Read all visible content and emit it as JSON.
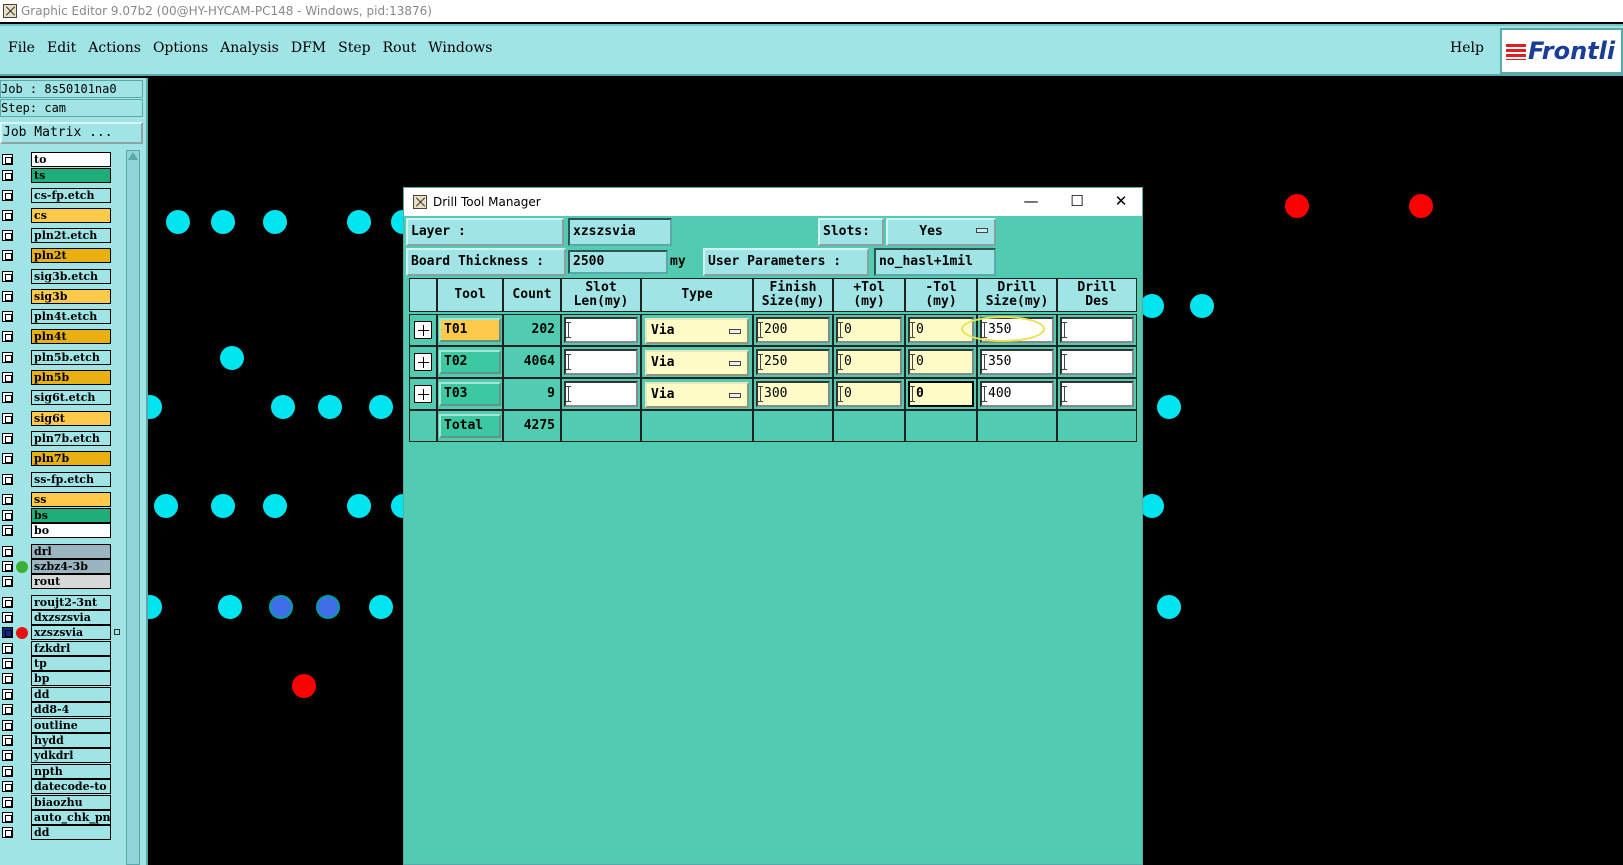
{
  "window_title": "Graphic Editor 9.07b2 (00@HY-HYCAM-PC148 - Windows, pid:13876)",
  "menu": [
    "File",
    "Edit",
    "Actions",
    "Options",
    "Analysis",
    "DFM",
    "Step",
    "Rout",
    "Windows"
  ],
  "help_label": "Help",
  "logo_text": "Frontli",
  "job_label": "Job : 8s50101na0",
  "step_label": "Step: cam",
  "job_matrix_label": "Job Matrix ...",
  "layers": [
    {
      "name": "to",
      "color": "#ffffff"
    },
    {
      "name": "ts",
      "color": "#1fae7a"
    },
    {
      "name": "cs-fp.etch",
      "color": "#a0e4e6"
    },
    {
      "name": "cs",
      "color": "#ffc94a"
    },
    {
      "name": "pln2t.etch",
      "color": "#a0e4e6"
    },
    {
      "name": "pln2t",
      "color": "#e8b010"
    },
    {
      "name": "sig3b.etch",
      "color": "#a0e4e6"
    },
    {
      "name": "sig3b",
      "color": "#ffc94a"
    },
    {
      "name": "pln4t.etch",
      "color": "#a0e4e6"
    },
    {
      "name": "pln4t",
      "color": "#e8b010"
    },
    {
      "name": "pln5b.etch",
      "color": "#a0e4e6"
    },
    {
      "name": "pln5b",
      "color": "#e8b010"
    },
    {
      "name": "sig6t.etch",
      "color": "#a0e4e6"
    },
    {
      "name": "sig6t",
      "color": "#ffc94a"
    },
    {
      "name": "pln7b.etch",
      "color": "#a0e4e6"
    },
    {
      "name": "pln7b",
      "color": "#e8b010"
    },
    {
      "name": "ss-fp.etch",
      "color": "#a0e4e6"
    },
    {
      "name": "ss",
      "color": "#ffc94a"
    },
    {
      "name": "bs",
      "color": "#1fae7a"
    },
    {
      "name": "bo",
      "color": "#ffffff"
    },
    {
      "name": "drl",
      "color": "#9ab4c0"
    },
    {
      "name": "szbz4-3b",
      "color": "#9ab4c0"
    },
    {
      "name": "rout",
      "color": "#d8d8d8"
    },
    {
      "name": "roujt2-3nt",
      "color": "#a0e4e6"
    },
    {
      "name": "dxzszsvia",
      "color": "#a0e4e6"
    },
    {
      "name": "xzszsvia",
      "color": "#a0e4e6"
    },
    {
      "name": "fzkdrl",
      "color": "#a0e4e6"
    },
    {
      "name": "tp",
      "color": "#a0e4e6"
    },
    {
      "name": "bp",
      "color": "#a0e4e6"
    },
    {
      "name": "dd",
      "color": "#a0e4e6"
    },
    {
      "name": "dd8-4",
      "color": "#a0e4e6"
    },
    {
      "name": "outline",
      "color": "#a0e4e6"
    },
    {
      "name": "hydd",
      "color": "#a0e4e6"
    },
    {
      "name": "ydkdrl",
      "color": "#a0e4e6"
    },
    {
      "name": "npth",
      "color": "#a0e4e6"
    },
    {
      "name": "datecode-to",
      "color": "#a0e4e6"
    },
    {
      "name": "biaozhu",
      "color": "#a0e4e6"
    },
    {
      "name": "auto_chk_pn",
      "color": "#a0e4e6"
    },
    {
      "name": "dd",
      "color": "#a0e4e6"
    }
  ],
  "dialog": {
    "title": "Drill Tool Manager",
    "layer_label": "Layer          :",
    "layer_value": "xzszsvia",
    "slots_label": "Slots:",
    "slots_value": "Yes",
    "board_thickness_label": "Board Thickness :",
    "board_thickness_value": "2500",
    "board_thickness_unit": "my",
    "user_params_label": "User Parameters :",
    "user_params_value": "no_hasl+1mil",
    "headers": {
      "tool": "Tool",
      "count": "Count",
      "slot_len": "Slot\nLen(my)",
      "type": "Type",
      "finish": "Finish\nSize(my)",
      "plus_tol": "+Tol\n(my)",
      "minus_tol": "-Tol\n(my)",
      "drill_size": "Drill\nSize(my)",
      "drill_des": "Drill\nDes"
    },
    "rows": [
      {
        "tool": "T01",
        "count": "202",
        "slot_len": "",
        "type": "Via",
        "finish": "200",
        "plus_tol": "0",
        "minus_tol": "0",
        "drill_size": "350",
        "drill_des": ""
      },
      {
        "tool": "T02",
        "count": "4064",
        "slot_len": "",
        "type": "Via",
        "finish": "250",
        "plus_tol": "0",
        "minus_tol": "0",
        "drill_size": "350",
        "drill_des": ""
      },
      {
        "tool": "T03",
        "count": "9",
        "slot_len": "",
        "type": "Via",
        "finish": "300",
        "plus_tol": "0",
        "minus_tol": "0",
        "drill_size": "400",
        "drill_des": ""
      }
    ],
    "total_label": "Total",
    "total_count": "4275"
  }
}
